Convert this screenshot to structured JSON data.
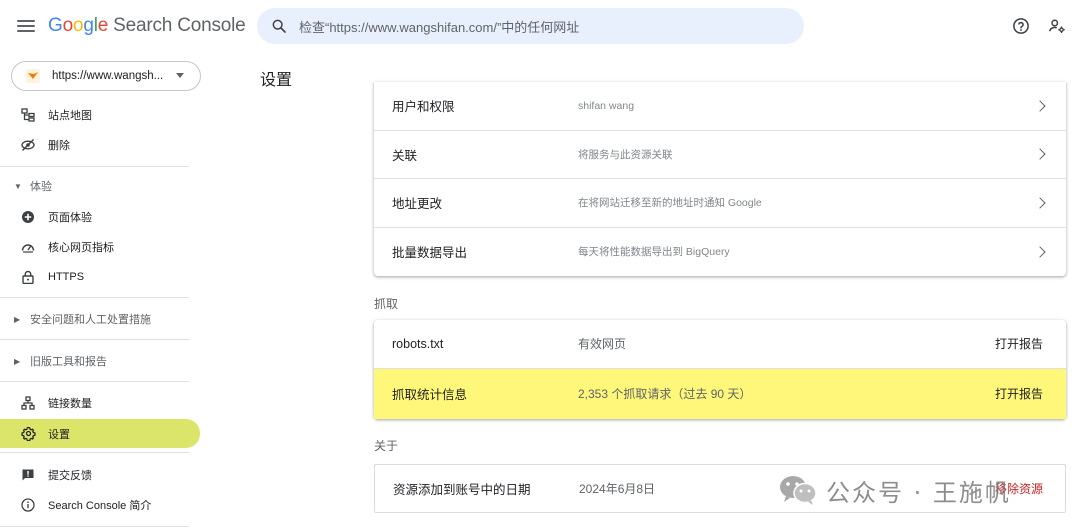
{
  "app": {
    "logo_google": [
      "G",
      "o",
      "o",
      "g",
      "l",
      "e"
    ],
    "logo_product": "Search Console"
  },
  "search": {
    "placeholder": "检查“https://www.wangshifan.com/”中的任何网址"
  },
  "property": {
    "label": "https://www.wangsh..."
  },
  "sidebar": {
    "top_items": [
      {
        "label": "站点地图",
        "icon": "sitemap-icon"
      },
      {
        "label": "删除",
        "icon": "removals-icon"
      }
    ],
    "experience_header": "体验",
    "experience_items": [
      {
        "label": "页面体验",
        "icon": "page-experience-icon"
      },
      {
        "label": "核心网页指标",
        "icon": "speedometer-icon"
      },
      {
        "label": "HTTPS",
        "icon": "lock-icon"
      }
    ],
    "security_header": "安全问题和人工处置措施",
    "legacy_header": "旧版工具和报告",
    "bottom_items": [
      {
        "label": "链接数量",
        "icon": "links-icon"
      },
      {
        "label": "设置",
        "icon": "gear-icon"
      }
    ],
    "footer_items": [
      {
        "label": "提交反馈",
        "icon": "feedback-icon"
      },
      {
        "label": "Search Console 简介",
        "icon": "info-icon"
      }
    ]
  },
  "main": {
    "title": "设置",
    "general_rows": [
      {
        "name": "用户和权限",
        "desc": "shifan wang"
      },
      {
        "name": "关联",
        "desc": "将服务与此资源关联"
      },
      {
        "name": "地址更改",
        "desc": "在将网站迁移至新的地址时通知 Google"
      },
      {
        "name": "批量数据导出",
        "desc": "每天将性能数据导出到 BigQuery"
      }
    ],
    "crawl_label": "抓取",
    "crawl_rows": [
      {
        "name": "robots.txt",
        "desc": "有效网页",
        "action": "打开报告"
      },
      {
        "name": "抓取统计信息",
        "desc": "2,353 个抓取请求（过去 90 天）",
        "action": "打开报告"
      }
    ],
    "about_label": "关于",
    "about_row": {
      "name": "资源添加到账号中的日期",
      "desc": "2024年6月8日",
      "action": "移除资源"
    }
  },
  "watermark": {
    "text": "公众号 · 王施帆"
  },
  "colors": {
    "highlight": "#fff77a",
    "active_nav": "#dbe56a",
    "search_bg": "#e8f0fe"
  }
}
